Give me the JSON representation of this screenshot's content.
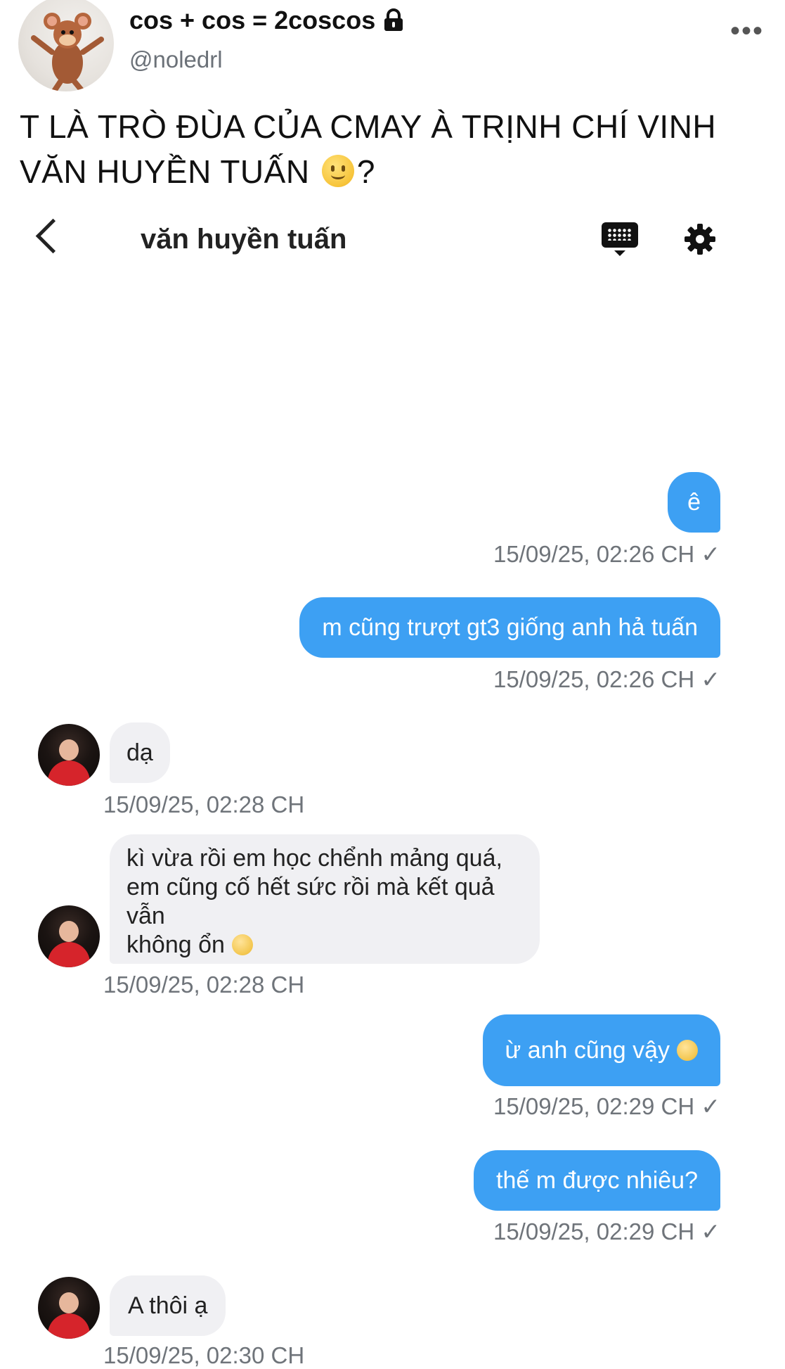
{
  "tweet": {
    "display_name": "cos + cos = 2coscos",
    "handle": "@noledrl",
    "more_label": "•••",
    "text_line1": "T LÀ TRÒ ĐÙA CỦA CMAY À TRỊNH CHÍ VINH",
    "text_line2_before": "VĂN HUYỀN TUẤN",
    "text_line2_after": "?"
  },
  "chat": {
    "title": "văn huyền tuấn",
    "messages": [
      {
        "side": "out",
        "text": "ê",
        "time": "15/09/25, 02:26 CH ✓"
      },
      {
        "side": "out",
        "text": "m cũng trượt gt3 giống anh hả tuấn",
        "time": "15/09/25, 02:26 CH ✓"
      },
      {
        "side": "in",
        "text": "dạ",
        "time": "15/09/25, 02:28 CH"
      },
      {
        "side": "in",
        "text_lines": [
          "kì vừa rồi em học chểnh mảng quá,",
          "em cũng cố hết sức rồi mà kết quả vẫn",
          "không ổn"
        ],
        "time": "15/09/25, 02:28 CH"
      },
      {
        "side": "out",
        "text": "ừ anh cũng vậy",
        "time": "15/09/25, 02:29 CH ✓"
      },
      {
        "side": "out",
        "text": "thế m được nhiêu?",
        "time": "15/09/25, 02:29 CH ✓"
      },
      {
        "side": "in",
        "text": "A thôi ạ",
        "time": "15/09/25, 02:30 CH"
      }
    ]
  },
  "colors": {
    "outgoing_bubble": "#3da0f3",
    "incoming_bubble": "#f0f0f3",
    "timestamp": "#6f747a"
  },
  "icons": [
    "lock-icon",
    "more-icon",
    "back-chevron-icon",
    "keyboard-icon",
    "gear-icon",
    "smile-emoji",
    "pensive-emoji",
    "sad-emoji"
  ]
}
